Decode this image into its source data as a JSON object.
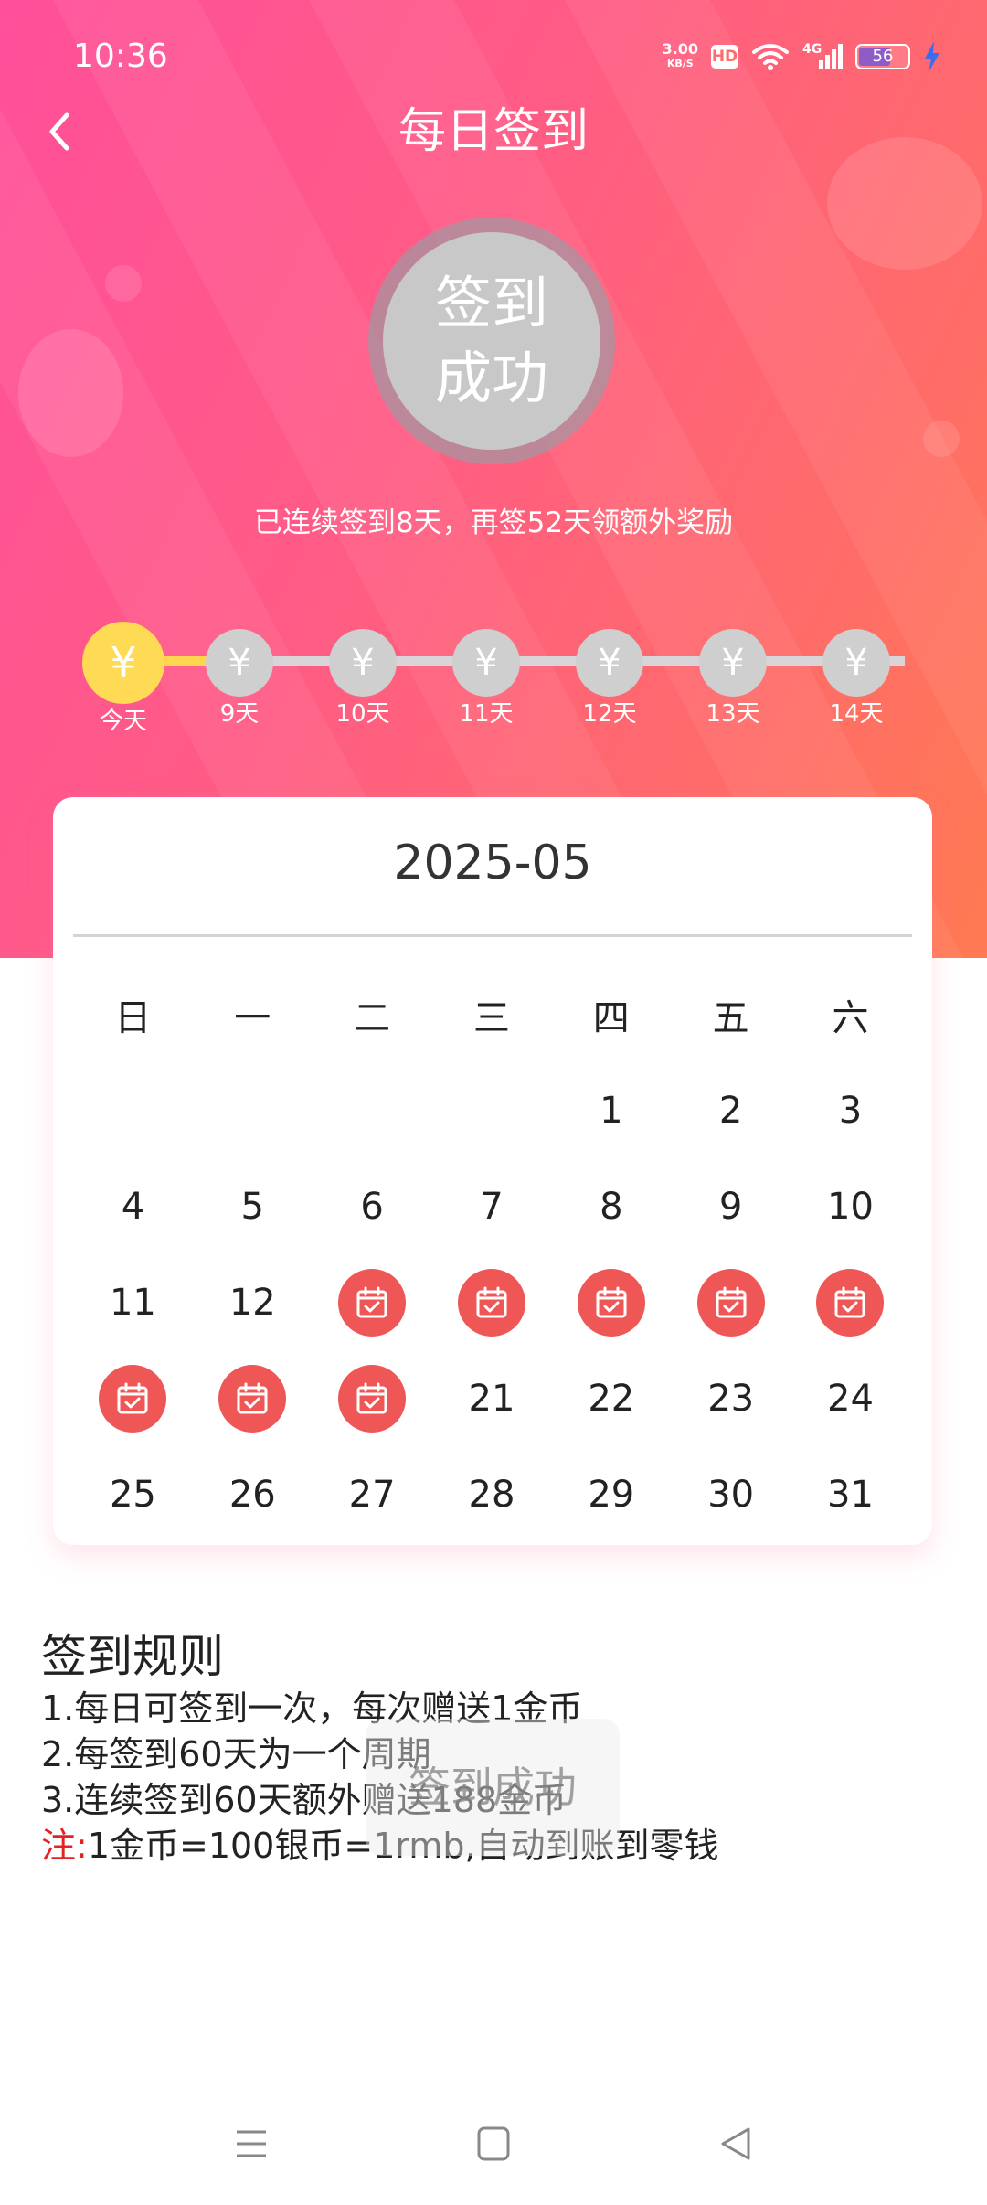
{
  "status_bar": {
    "time": "10:36",
    "net_speed": "3.00",
    "net_unit": "KB/S",
    "hd": "HD",
    "signal": "4G",
    "battery": "56",
    "battery_level": 56
  },
  "header": {
    "title": "每日签到"
  },
  "badge": {
    "line1": "签到",
    "line2": "成功"
  },
  "streak_text": "已连续签到8天，再签52天领额外奖励",
  "progress": {
    "coin_symbol": "¥",
    "days": [
      "今天",
      "9天",
      "10天",
      "11天",
      "12天",
      "13天",
      "14天"
    ]
  },
  "calendar": {
    "month": "2025-05",
    "weekdays": [
      "日",
      "一",
      "二",
      "三",
      "四",
      "五",
      "六"
    ],
    "weeks": [
      [
        "",
        "",
        "",
        "",
        "1",
        "2",
        "3"
      ],
      [
        "4",
        "5",
        "6",
        "7",
        "8",
        "9",
        "10"
      ],
      [
        "11",
        "12",
        "13",
        "14",
        "15",
        "16",
        "17"
      ],
      [
        "18",
        "19",
        "20",
        "21",
        "22",
        "23",
        "24"
      ],
      [
        "25",
        "26",
        "27",
        "28",
        "29",
        "30",
        "31"
      ]
    ],
    "signed_days": [
      "13",
      "14",
      "15",
      "16",
      "17",
      "18",
      "19",
      "20"
    ],
    "stamp_icon": "calendar-check-icon",
    "stamp_color": "#ef5757"
  },
  "rules": {
    "heading": "签到规则",
    "lines": [
      "1.每日可签到一次，每次赠送1金币",
      "2.每签到60天为一个周期",
      "3.连续签到60天额外赠送188金币"
    ],
    "note_prefix": "注:",
    "note_text": "1金币=100银币=1rmb,自动到账到零钱"
  },
  "toast": "签到成功",
  "colors": {
    "gradient_start": "#ff4f9a",
    "gradient_end": "#ff7a52",
    "today_coin": "#ffdb55",
    "stamp": "#ef5757",
    "note_red": "#e52222"
  }
}
